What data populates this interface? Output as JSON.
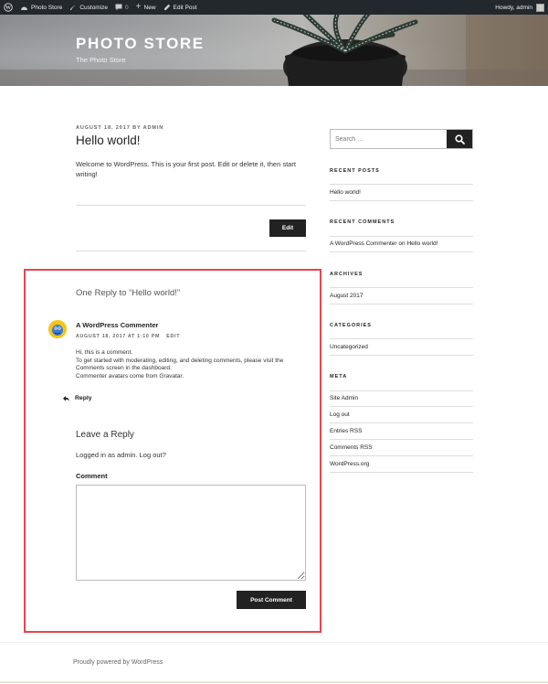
{
  "adminbar": {
    "site_name": "Photo Store",
    "customize": "Customize",
    "comments_count": "0",
    "new": "New",
    "edit_post": "Edit Post",
    "howdy": "Howdy, admin"
  },
  "header": {
    "title": "PHOTO STORE",
    "description": "The Photo Store"
  },
  "post": {
    "meta": "AUGUST 18, 2017 BY ADMIN",
    "title": "Hello world!",
    "body": "Welcome to WordPress. This is your first post. Edit or delete it, then start writing!",
    "edit_button": "Edit"
  },
  "comments": {
    "reply_title": "One Reply to “Hello world!”",
    "author": "A WordPress Commenter",
    "meta": "AUGUST 18, 2017 AT 1:10 PM",
    "edit": "EDIT",
    "lines": [
      "Hi, this is a comment.",
      "To get started with moderating, editing, and deleting comments, please visit the Comments screen in the dashboard.",
      "Commenter avatars come from Gravatar."
    ],
    "reply_link": "Reply"
  },
  "respond": {
    "title": "Leave a Reply",
    "logged_in": "Logged in as admin. Log out?",
    "comment_label": "Comment",
    "comment_value": "",
    "submit": "Post Comment"
  },
  "sidebar": {
    "search_placeholder": "Search …",
    "recent_posts_title": "RECENT POSTS",
    "recent_posts": [
      "Hello world!"
    ],
    "recent_comments_title": "RECENT COMMENTS",
    "recent_comment": {
      "author": "A WordPress Commenter",
      "on": "on",
      "post": "Hello world!"
    },
    "archives_title": "ARCHIVES",
    "archives": [
      "August 2017"
    ],
    "categories_title": "CATEGORIES",
    "categories": [
      "Uncategorized"
    ],
    "meta_title": "META",
    "meta_items": [
      "Site Admin",
      "Log out",
      "Entries RSS",
      "Comments RSS",
      "WordPress.org"
    ]
  },
  "footer": {
    "text": "Proudly powered by WordPress"
  },
  "colors": {
    "adminbar_bg": "#23282d",
    "button_bg": "#222222",
    "highlight_border": "#e8444e"
  }
}
